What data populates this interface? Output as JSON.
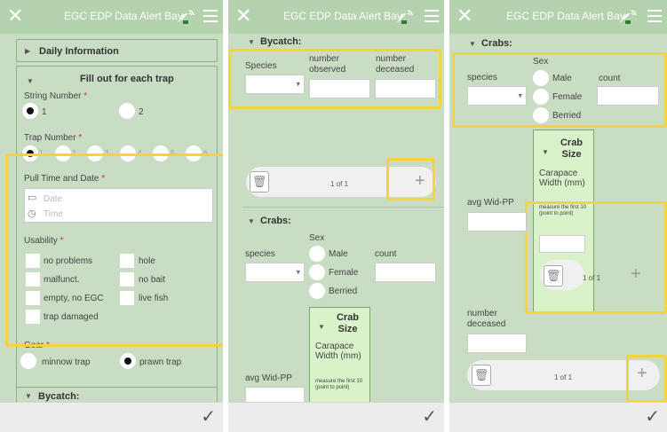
{
  "app_title": "EGC EDP Data Alert Bay",
  "icons": {
    "close": "close-icon",
    "satellite": "satellite-dish-icon",
    "menu": "hamburger-menu-icon",
    "check": "checkmark-icon",
    "trash": "trash-icon",
    "add": "plus-icon"
  },
  "highlight_color": "#f5d33c",
  "p1": {
    "daily_info": "Daily Information",
    "section": "Fill out for each trap",
    "string_number": "String Number",
    "string_opts": [
      "1",
      "2"
    ],
    "trap_number": "Trap Number",
    "trap_opts": [
      "1",
      "2",
      "3",
      "4",
      "5",
      "6"
    ],
    "pull_time": "Pull Time and Date",
    "date_ph": "Date",
    "time_ph": "Time",
    "usability": "Usability",
    "usability_opts": [
      "no problems",
      "hole",
      "malfunct.",
      "no bait",
      "empty, no EGC",
      "live fish",
      "trap damaged"
    ],
    "gear": "Gear",
    "gear_opts": [
      "minnow trap",
      "prawn trap"
    ],
    "bycatch": "Bycatch:",
    "req": "*"
  },
  "p2": {
    "bycatch": "Bycatch:",
    "species": "Species",
    "number_observed": "number observed",
    "number_deceased": "number deceased",
    "pager": "1 of 1",
    "crabs": "Crabs:",
    "species_lc": "species",
    "sex": "Sex",
    "sex_opts": [
      "Male",
      "Female",
      "Berried"
    ],
    "count": "count",
    "crab_size": "Crab Size",
    "carapace": "Carapace Width (mm)",
    "measure": "measure the first 10 (point to point)",
    "avg": "avg Wid-PP"
  },
  "p3": {
    "crabs": "Crabs:",
    "species": "species",
    "sex": "Sex",
    "sex_opts": [
      "Male",
      "Female",
      "Berried"
    ],
    "count": "count",
    "crab_size": "Crab Size",
    "carapace": "Carapace Width (mm)",
    "measure": "measure the first 10 (point to point)",
    "avg": "avg Wid-PP",
    "inner_pager": "1 of 1",
    "number_deceased": "number deceased",
    "pager": "1 of 1"
  }
}
